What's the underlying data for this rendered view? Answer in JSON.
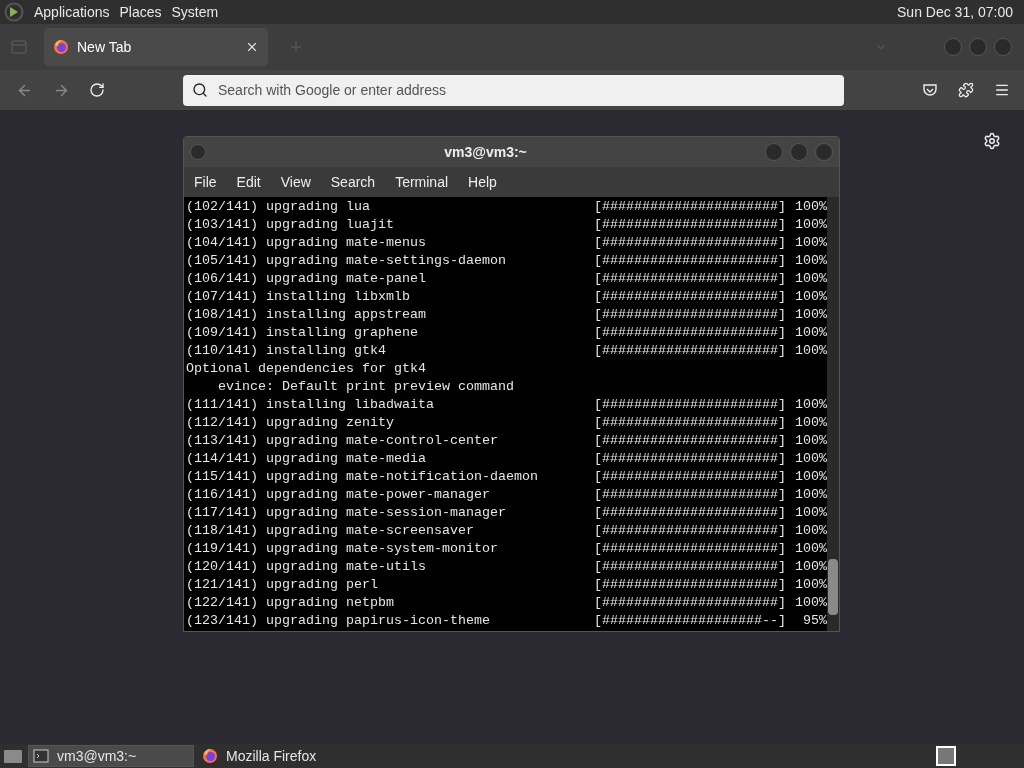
{
  "top_panel": {
    "menus": [
      "Applications",
      "Places",
      "System"
    ],
    "clock": "Sun Dec 31, 07:00"
  },
  "browser": {
    "tabs": [
      {
        "title": "New Tab",
        "selected": true
      }
    ],
    "address_bar": {
      "placeholder": "Search with Google or enter address"
    }
  },
  "terminal": {
    "title": "vm3@vm3:~",
    "menus": [
      "File",
      "Edit",
      "View",
      "Search",
      "Terminal",
      "Help"
    ],
    "lines": [
      {
        "kind": "progress",
        "label": "(102/141) upgrading lua",
        "bar": "[######################]",
        "percent": "100%"
      },
      {
        "kind": "progress",
        "label": "(103/141) upgrading luajit",
        "bar": "[######################]",
        "percent": "100%"
      },
      {
        "kind": "progress",
        "label": "(104/141) upgrading mate-menus",
        "bar": "[######################]",
        "percent": "100%"
      },
      {
        "kind": "progress",
        "label": "(105/141) upgrading mate-settings-daemon",
        "bar": "[######################]",
        "percent": "100%"
      },
      {
        "kind": "progress",
        "label": "(106/141) upgrading mate-panel",
        "bar": "[######################]",
        "percent": "100%"
      },
      {
        "kind": "progress",
        "label": "(107/141) installing libxmlb",
        "bar": "[######################]",
        "percent": "100%"
      },
      {
        "kind": "progress",
        "label": "(108/141) installing appstream",
        "bar": "[######################]",
        "percent": "100%"
      },
      {
        "kind": "progress",
        "label": "(109/141) installing graphene",
        "bar": "[######################]",
        "percent": "100%"
      },
      {
        "kind": "progress",
        "label": "(110/141) installing gtk4",
        "bar": "[######################]",
        "percent": "100%"
      },
      {
        "kind": "text",
        "text": "Optional dependencies for gtk4"
      },
      {
        "kind": "text",
        "text": "    evince: Default print preview command"
      },
      {
        "kind": "progress",
        "label": "(111/141) installing libadwaita",
        "bar": "[######################]",
        "percent": "100%"
      },
      {
        "kind": "progress",
        "label": "(112/141) upgrading zenity",
        "bar": "[######################]",
        "percent": "100%"
      },
      {
        "kind": "progress",
        "label": "(113/141) upgrading mate-control-center",
        "bar": "[######################]",
        "percent": "100%"
      },
      {
        "kind": "progress",
        "label": "(114/141) upgrading mate-media",
        "bar": "[######################]",
        "percent": "100%"
      },
      {
        "kind": "progress",
        "label": "(115/141) upgrading mate-notification-daemon",
        "bar": "[######################]",
        "percent": "100%"
      },
      {
        "kind": "progress",
        "label": "(116/141) upgrading mate-power-manager",
        "bar": "[######################]",
        "percent": "100%"
      },
      {
        "kind": "progress",
        "label": "(117/141) upgrading mate-session-manager",
        "bar": "[######################]",
        "percent": "100%"
      },
      {
        "kind": "progress",
        "label": "(118/141) upgrading mate-screensaver",
        "bar": "[######################]",
        "percent": "100%"
      },
      {
        "kind": "progress",
        "label": "(119/141) upgrading mate-system-monitor",
        "bar": "[######################]",
        "percent": "100%"
      },
      {
        "kind": "progress",
        "label": "(120/141) upgrading mate-utils",
        "bar": "[######################]",
        "percent": "100%"
      },
      {
        "kind": "progress",
        "label": "(121/141) upgrading perl",
        "bar": "[######################]",
        "percent": "100%"
      },
      {
        "kind": "progress",
        "label": "(122/141) upgrading netpbm",
        "bar": "[######################]",
        "percent": "100%"
      },
      {
        "kind": "progress",
        "label": "(123/141) upgrading papirus-icon-theme",
        "bar": "[####################--]",
        "percent": "95%"
      }
    ]
  },
  "taskbar": {
    "items": [
      {
        "label": "vm3@vm3:~",
        "kind": "terminal",
        "selected": true
      },
      {
        "label": "Mozilla Firefox",
        "kind": "browser",
        "selected": false
      }
    ]
  }
}
